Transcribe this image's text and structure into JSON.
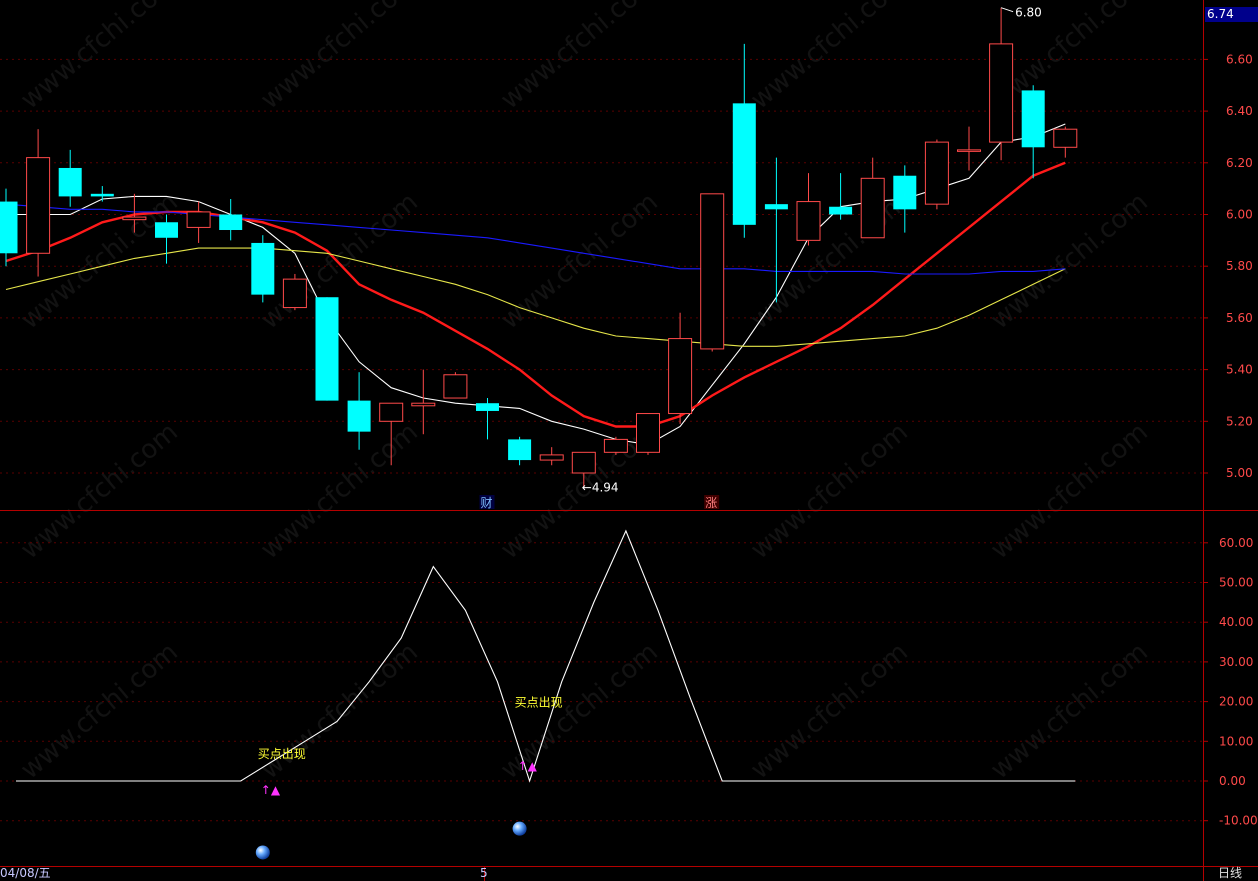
{
  "chart_data": [
    {
      "type": "candlestick",
      "ylim": [
        4.88,
        6.8
      ],
      "yticks": [
        5.0,
        5.2,
        5.4,
        5.6,
        5.8,
        6.0,
        6.2,
        6.4,
        6.6
      ],
      "ytick_labels": [
        "5.00",
        "5.20",
        "5.40",
        "5.60",
        "5.80",
        "6.00",
        "6.20",
        "6.40",
        "6.60"
      ],
      "current_price_label": "6.74",
      "high_annotation": "6.80",
      "low_annotation": "4.94",
      "markers": [
        {
          "text": "财",
          "index": 15
        },
        {
          "text": "涨",
          "index": 22
        }
      ],
      "candles": [
        {
          "o": 6.05,
          "h": 6.1,
          "l": 5.8,
          "c": 5.85
        },
        {
          "o": 5.85,
          "h": 6.33,
          "l": 5.76,
          "c": 6.22
        },
        {
          "o": 6.18,
          "h": 6.25,
          "l": 6.03,
          "c": 6.07
        },
        {
          "o": 6.08,
          "h": 6.11,
          "l": 6.05,
          "c": 6.07
        },
        {
          "o": 5.98,
          "h": 6.08,
          "l": 5.93,
          "c": 5.99
        },
        {
          "o": 5.97,
          "h": 6.0,
          "l": 5.81,
          "c": 5.91
        },
        {
          "o": 5.95,
          "h": 6.05,
          "l": 5.89,
          "c": 6.01
        },
        {
          "o": 6.0,
          "h": 6.06,
          "l": 5.9,
          "c": 5.94
        },
        {
          "o": 5.89,
          "h": 5.92,
          "l": 5.66,
          "c": 5.69
        },
        {
          "o": 5.64,
          "h": 5.77,
          "l": 5.63,
          "c": 5.75
        },
        {
          "o": 5.68,
          "h": 5.68,
          "l": 5.28,
          "c": 5.28
        },
        {
          "o": 5.28,
          "h": 5.39,
          "l": 5.09,
          "c": 5.16
        },
        {
          "o": 5.2,
          "h": 5.27,
          "l": 5.03,
          "c": 5.27
        },
        {
          "o": 5.26,
          "h": 5.4,
          "l": 5.15,
          "c": 5.27
        },
        {
          "o": 5.29,
          "h": 5.39,
          "l": 5.29,
          "c": 5.38
        },
        {
          "o": 5.27,
          "h": 5.29,
          "l": 5.13,
          "c": 5.24
        },
        {
          "o": 5.13,
          "h": 5.14,
          "l": 5.03,
          "c": 5.05
        },
        {
          "o": 5.05,
          "h": 5.1,
          "l": 5.03,
          "c": 5.07
        },
        {
          "o": 5.0,
          "h": 5.08,
          "l": 4.94,
          "c": 5.08
        },
        {
          "o": 5.08,
          "h": 5.14,
          "l": 5.07,
          "c": 5.13
        },
        {
          "o": 5.08,
          "h": 5.23,
          "l": 5.07,
          "c": 5.23
        },
        {
          "o": 5.23,
          "h": 5.62,
          "l": 5.19,
          "c": 5.52
        },
        {
          "o": 5.48,
          "h": 6.08,
          "l": 5.47,
          "c": 6.08
        },
        {
          "o": 6.43,
          "h": 6.66,
          "l": 5.91,
          "c": 5.96
        },
        {
          "o": 6.04,
          "h": 6.22,
          "l": 5.66,
          "c": 6.02
        },
        {
          "o": 5.9,
          "h": 6.16,
          "l": 5.88,
          "c": 6.05
        },
        {
          "o": 6.03,
          "h": 6.16,
          "l": 5.98,
          "c": 6.0
        },
        {
          "o": 5.91,
          "h": 6.22,
          "l": 5.91,
          "c": 6.14
        },
        {
          "o": 6.15,
          "h": 6.19,
          "l": 5.93,
          "c": 6.02
        },
        {
          "o": 6.04,
          "h": 6.29,
          "l": 6.02,
          "c": 6.28
        },
        {
          "o": 6.25,
          "h": 6.34,
          "l": 6.17,
          "c": 6.25
        },
        {
          "o": 6.28,
          "h": 6.8,
          "l": 6.21,
          "c": 6.66
        },
        {
          "o": 6.48,
          "h": 6.5,
          "l": 6.14,
          "c": 6.26
        },
        {
          "o": 6.26,
          "h": 6.34,
          "l": 6.22,
          "c": 6.33
        }
      ],
      "series": [
        {
          "name": "",
          "color": "#ffffff",
          "values": [
            6.0,
            6.0,
            6.0,
            6.06,
            6.07,
            6.07,
            6.05,
            6.0,
            5.95,
            5.85,
            5.6,
            5.43,
            5.33,
            5.29,
            5.27,
            5.26,
            5.25,
            5.2,
            5.17,
            5.13,
            5.11,
            5.18,
            5.34,
            5.5,
            5.68,
            5.91,
            6.03,
            6.05,
            6.06,
            6.1,
            6.14,
            6.28,
            6.3,
            6.35
          ]
        },
        {
          "name": "",
          "color": "#ff1a1a",
          "values": [
            5.82,
            5.86,
            5.91,
            5.97,
            6.0,
            6.01,
            6.01,
            5.99,
            5.97,
            5.93,
            5.86,
            5.73,
            5.67,
            5.62,
            5.55,
            5.48,
            5.4,
            5.3,
            5.22,
            5.18,
            5.18,
            5.22,
            5.3,
            5.37,
            5.43,
            5.49,
            5.56,
            5.65,
            5.75,
            5.85,
            5.95,
            6.05,
            6.15,
            6.2
          ]
        },
        {
          "name": "",
          "color": "#e6e64a",
          "values": [
            5.71,
            5.74,
            5.77,
            5.8,
            5.83,
            5.85,
            5.87,
            5.87,
            5.87,
            5.86,
            5.85,
            5.82,
            5.79,
            5.76,
            5.73,
            5.69,
            5.64,
            5.6,
            5.56,
            5.53,
            5.52,
            5.51,
            5.5,
            5.49,
            5.49,
            5.5,
            5.51,
            5.52,
            5.53,
            5.56,
            5.61,
            5.67,
            5.73,
            5.79
          ]
        },
        {
          "name": "",
          "color": "#1a1aff",
          "values": [
            6.04,
            6.03,
            6.02,
            6.02,
            6.01,
            6.01,
            6.0,
            5.99,
            5.98,
            5.97,
            5.96,
            5.95,
            5.94,
            5.93,
            5.92,
            5.91,
            5.89,
            5.87,
            5.85,
            5.83,
            5.81,
            5.79,
            5.79,
            5.79,
            5.78,
            5.78,
            5.78,
            5.78,
            5.77,
            5.77,
            5.77,
            5.78,
            5.78,
            5.79
          ]
        }
      ]
    },
    {
      "type": "line",
      "ylim": [
        -20,
        68
      ],
      "yticks": [
        -10,
        0,
        10,
        20,
        30,
        40,
        50,
        60
      ],
      "ytick_labels": [
        "-10.00",
        "0.00",
        "10.00",
        "20.00",
        "30.00",
        "40.00",
        "50.00",
        "60.00"
      ],
      "series": [
        {
          "name": "",
          "color": "#ffffff",
          "values": [
            0,
            0,
            0,
            0,
            0,
            0,
            0,
            0,
            5,
            10,
            15,
            25,
            36,
            54,
            43,
            25,
            0,
            25,
            45,
            63,
            43,
            21,
            0,
            0,
            0,
            0,
            0,
            0,
            0,
            0,
            0,
            0,
            0,
            0
          ]
        }
      ],
      "annotations": [
        {
          "text": "买点出现",
          "index": 8,
          "y": 7
        },
        {
          "text": "买点出现",
          "index": 16,
          "y": 20
        }
      ],
      "arrows": [
        {
          "text": "↑▲",
          "index": 8,
          "y": -2
        },
        {
          "text": "↑▲",
          "index": 16,
          "y": 4
        }
      ],
      "balls": [
        {
          "index": 8,
          "y": -18
        },
        {
          "index": 16,
          "y": -12
        }
      ]
    }
  ],
  "footer": {
    "date_label": "04/08/五",
    "mid_label": "5",
    "period_label": "日线"
  },
  "watermark": "www.cfchi.com",
  "colors": {
    "up": "#ff4a4a",
    "down": "#00ffff",
    "axis": "#b40000",
    "grid": "#5a0000",
    "tick_text": "#ff4a4a"
  }
}
